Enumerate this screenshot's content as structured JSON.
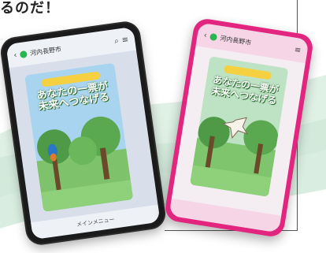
{
  "heading": "るのだ！",
  "left_phone": {
    "account_name": "河内長野市",
    "card_title_line1": "あなたの一票が",
    "card_title_line2": "未来へつなげる",
    "menu_label": "メインメニュー"
  },
  "right_phone": {
    "account_name": "河内長野市",
    "card_title_line1": "あなたの一票が",
    "card_title_line2": "未来へつなげる"
  },
  "colors": {
    "right_phone_case": "#e2257f",
    "line_green": "#27b64f",
    "wave": "#cfe8d8"
  }
}
